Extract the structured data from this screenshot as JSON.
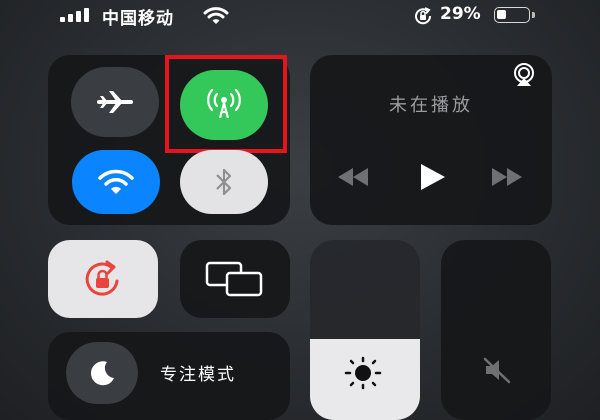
{
  "status_bar": {
    "carrier": "中国移动",
    "battery_percent": "29%",
    "battery_level": 0.29,
    "icons": [
      "signal-icon",
      "wifi-icon",
      "orientation-lock-icon",
      "battery-icon"
    ]
  },
  "connectivity": {
    "airplane_mode": {
      "icon": "airplane-icon",
      "enabled": false
    },
    "cellular_data": {
      "icon": "antenna-icon",
      "enabled": true,
      "highlighted": true
    },
    "wifi": {
      "icon": "wifi-icon",
      "enabled": true
    },
    "bluetooth": {
      "icon": "bluetooth-icon",
      "enabled": false
    }
  },
  "media": {
    "now_playing": "未在播放",
    "controls": [
      "previous-icon",
      "play-icon",
      "next-icon"
    ],
    "airplay_icon": "airplay-icon"
  },
  "orientation_lock": {
    "icon": "orientation-lock-icon",
    "enabled": true
  },
  "screen_mirroring": {
    "icon": "screen-mirroring-icon"
  },
  "focus": {
    "label": "专注模式",
    "icon": "moon-icon"
  },
  "brightness": {
    "icon": "sun-icon",
    "level": 0.45
  },
  "volume": {
    "icon": "mute-icon",
    "level": 0
  },
  "colors": {
    "cellular_on": "#34c759",
    "wifi_on": "#0a84ff",
    "highlight_box": "#e8141b",
    "orientation_lock": "#e8453c"
  }
}
